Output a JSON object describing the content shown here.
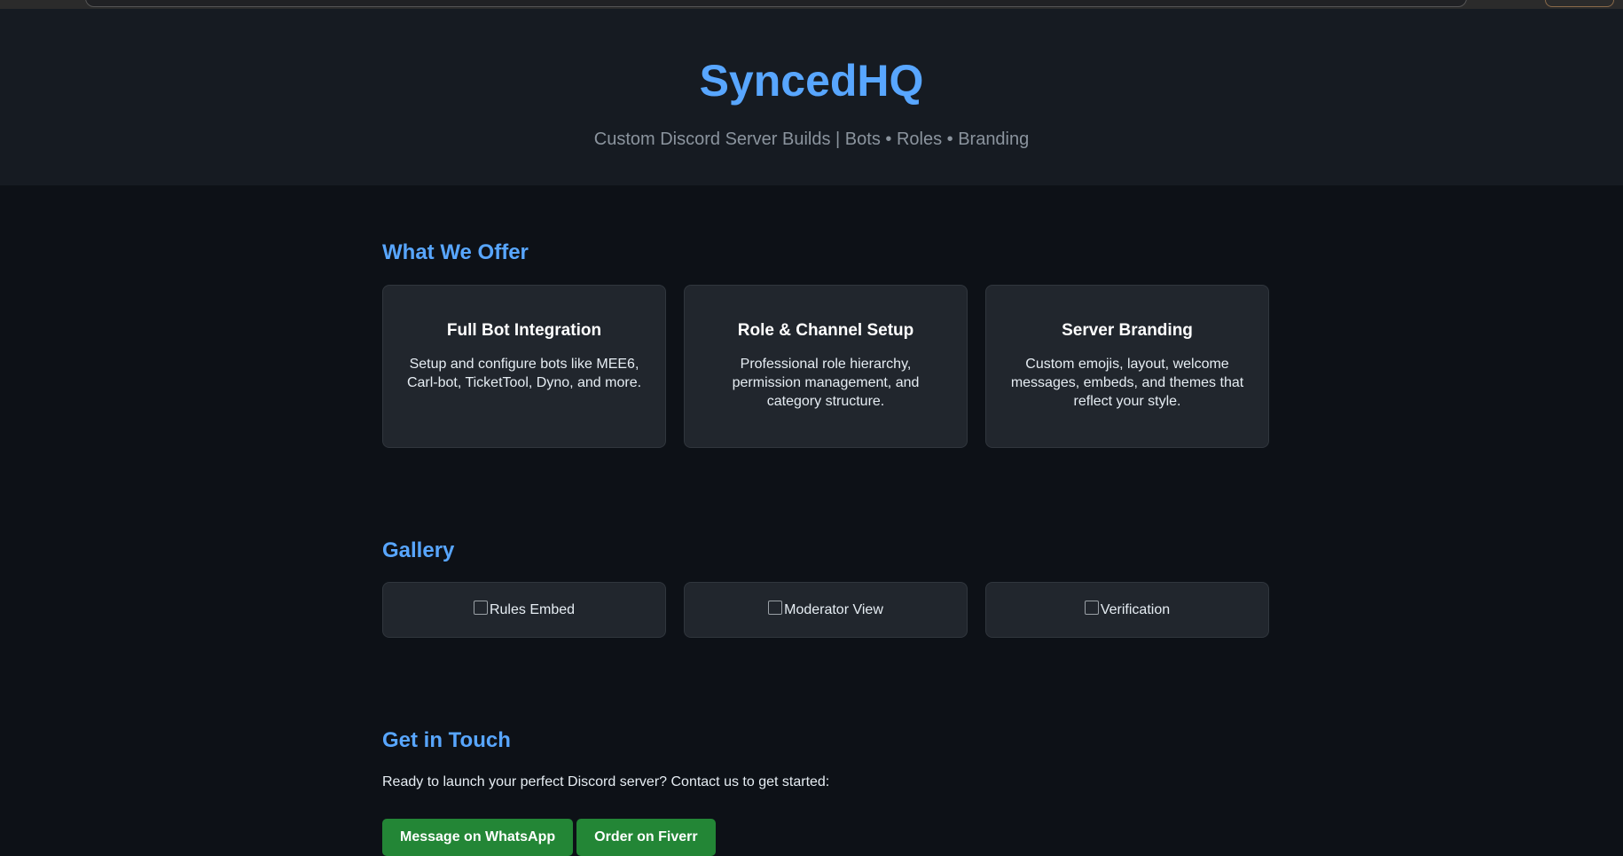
{
  "header": {
    "title": "SyncedHQ",
    "tagline": "Custom Discord Server Builds | Bots • Roles • Branding"
  },
  "offer": {
    "heading": "What We Offer",
    "cards": [
      {
        "title": "Full Bot Integration",
        "description": "Setup and configure bots like MEE6, Carl-bot, TicketTool, Dyno, and more."
      },
      {
        "title": "Role & Channel Setup",
        "description": "Professional role hierarchy, permission management, and category structure."
      },
      {
        "title": "Server Branding",
        "description": "Custom emojis, layout, welcome messages, embeds, and themes that reflect your style."
      }
    ]
  },
  "gallery": {
    "heading": "Gallery",
    "images": [
      {
        "alt": "Rules Embed"
      },
      {
        "alt": "Moderator View"
      },
      {
        "alt": "Verification"
      }
    ]
  },
  "contact": {
    "heading": "Get in Touch",
    "text": "Ready to launch your perfect Discord server? Contact us to get started:",
    "buttons": [
      {
        "label": "Message on WhatsApp"
      },
      {
        "label": "Order on Fiverr"
      }
    ]
  },
  "colors": {
    "page_bg": "#0d1117",
    "header_bg": "#161b22",
    "card_bg": "#21262d",
    "accent": "#58a6ff",
    "button_green": "#238636"
  }
}
